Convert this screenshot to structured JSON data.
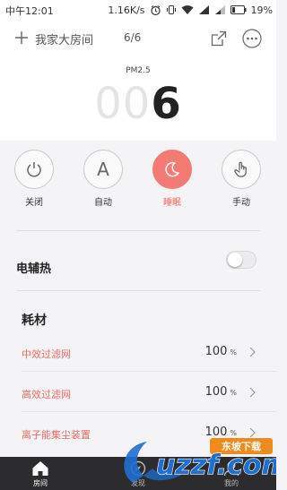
{
  "status_bar": {
    "time": "中午12:01",
    "speed": "1.16K/s",
    "battery": "19%"
  },
  "header": {
    "room_name": "我家大房间",
    "room_index": "6/6",
    "icons": [
      "plus-icon",
      "share-icon",
      "more-icon"
    ]
  },
  "air_quality": {
    "label": "PM2.5",
    "leading_zeros": "00",
    "value": "6"
  },
  "modes": [
    {
      "label": "关闭",
      "icon": "power-icon",
      "active": false
    },
    {
      "label": "自动",
      "icon": "letter-a-icon",
      "active": false
    },
    {
      "label": "睡眠",
      "icon": "moon-icon",
      "active": true
    },
    {
      "label": "手动",
      "icon": "hand-icon",
      "active": false
    }
  ],
  "heater": {
    "label": "电辅热",
    "enabled": false
  },
  "consumables": {
    "title": "耗材",
    "items": [
      {
        "name": "中效过滤网",
        "value": "100",
        "unit": "%"
      },
      {
        "name": "高效过滤网",
        "value": "100",
        "unit": "%"
      },
      {
        "name": "离子能集尘装置",
        "value": "100",
        "unit": "%"
      }
    ]
  },
  "bottom_nav": [
    {
      "label": "房间",
      "icon": "home-icon",
      "active": true
    },
    {
      "label": "发现",
      "icon": "discover-icon",
      "active": false
    },
    {
      "label": "我的",
      "icon": "profile-icon",
      "active": false
    }
  ],
  "watermark": {
    "badge": "东坡下载",
    "brand": "uzzf.com"
  },
  "colors": {
    "accent": "#f47b73",
    "accent_text": "#ef6b63",
    "nav_background": "#2c2c2e",
    "watermark_blue": "#1f6fd1",
    "watermark_orange": "#f08a1c"
  }
}
